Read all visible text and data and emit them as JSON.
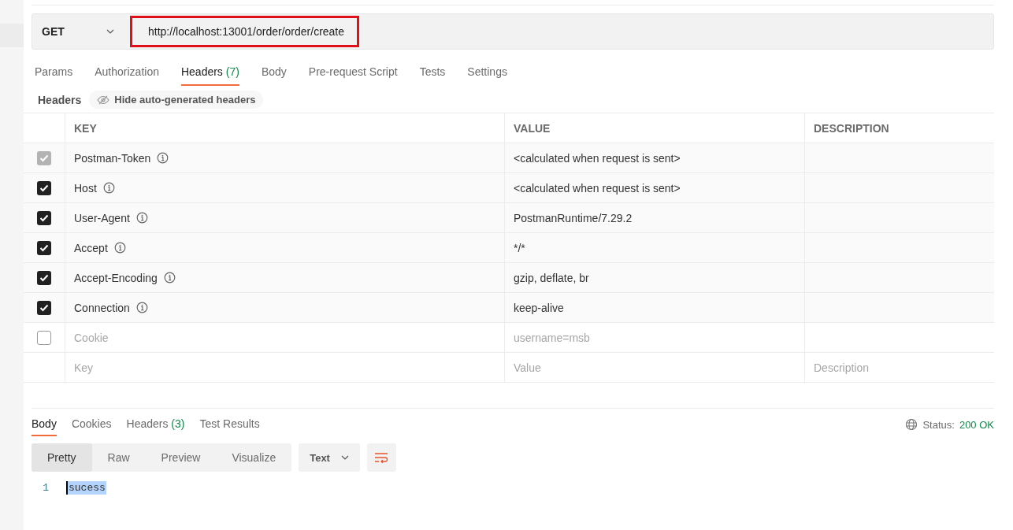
{
  "request": {
    "method": "GET",
    "url": "http://localhost:13001/order/order/create"
  },
  "request_tabs": [
    {
      "label": "Params",
      "selected": false
    },
    {
      "label": "Authorization",
      "selected": false
    },
    {
      "label": "Headers",
      "count": "(7)",
      "selected": true
    },
    {
      "label": "Body",
      "selected": false
    },
    {
      "label": "Pre-request Script",
      "selected": false
    },
    {
      "label": "Tests",
      "selected": false
    },
    {
      "label": "Settings",
      "selected": false
    }
  ],
  "headers_bar": {
    "title": "Headers",
    "toggle": "Hide auto-generated headers"
  },
  "table": {
    "columns": [
      "KEY",
      "VALUE",
      "DESCRIPTION"
    ],
    "rows": [
      {
        "kind": "header",
        "key": "Postman-Token",
        "value": "<calculated when request is sent>",
        "checked": true,
        "disabled": true,
        "info": true
      },
      {
        "kind": "header",
        "key": "Host",
        "value": "<calculated when request is sent>",
        "checked": true,
        "disabled": false,
        "info": true
      },
      {
        "kind": "header",
        "key": "User-Agent",
        "value": "PostmanRuntime/7.29.2",
        "checked": true,
        "disabled": false,
        "info": true
      },
      {
        "kind": "header",
        "key": "Accept",
        "value": "*/*",
        "checked": true,
        "disabled": false,
        "info": true
      },
      {
        "kind": "header",
        "key": "Accept-Encoding",
        "value": "gzip, deflate, br",
        "checked": true,
        "disabled": false,
        "info": true
      },
      {
        "kind": "header",
        "key": "Connection",
        "value": "keep-alive",
        "checked": true,
        "disabled": false,
        "info": true
      },
      {
        "kind": "header",
        "key": "Cookie",
        "value": "username=msb",
        "checked": false,
        "info": false
      },
      {
        "kind": "new",
        "key_placeholder": "Key",
        "value_placeholder": "Value",
        "description_placeholder": "Description"
      }
    ]
  },
  "response_tabs": [
    {
      "label": "Body",
      "selected": true
    },
    {
      "label": "Cookies",
      "selected": false
    },
    {
      "label": "Headers",
      "count": "(3)",
      "selected": false
    },
    {
      "label": "Test Results",
      "selected": false
    }
  ],
  "status": {
    "label": "Status:",
    "value": "200 OK"
  },
  "view_modes": [
    {
      "label": "Pretty",
      "selected": true
    },
    {
      "label": "Raw",
      "selected": false
    },
    {
      "label": "Preview",
      "selected": false
    },
    {
      "label": "Visualize",
      "selected": false
    }
  ],
  "format": "Text",
  "code": [
    {
      "line": "1",
      "text": "sucess",
      "selected": true
    }
  ]
}
